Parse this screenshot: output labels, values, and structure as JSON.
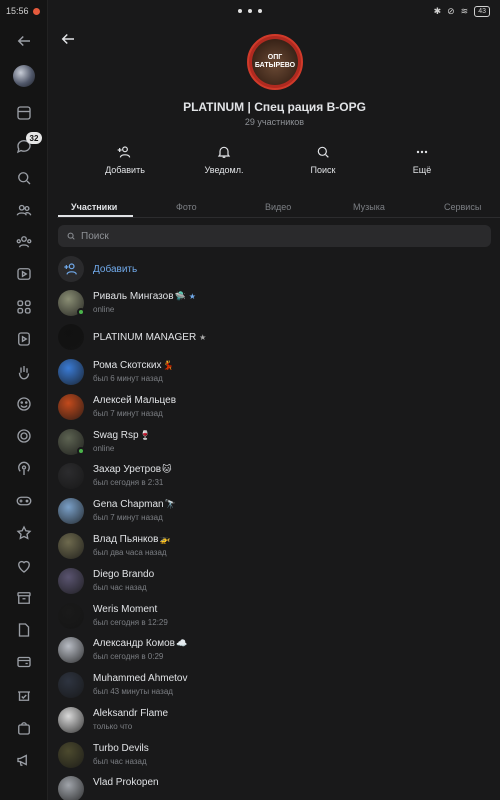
{
  "status_bar": {
    "time": "15:56",
    "battery": "43"
  },
  "sidebar": {
    "unread_badge": "32",
    "icons": [
      "back-arrow-icon",
      "avatar",
      "window-icon",
      "chat-icon",
      "search-icon",
      "friends-icon",
      "groups-icon",
      "clips-icon",
      "apps-icon",
      "video-icon",
      "hand-icon",
      "smile-icon",
      "target-icon",
      "podcast-icon",
      "gamepad-icon",
      "star-icon",
      "heart-icon",
      "archive-icon",
      "document-icon",
      "wallet-icon",
      "market-icon",
      "bag-icon",
      "megaphone-icon"
    ]
  },
  "group": {
    "avatar_text": "ОПГ БАТЫРЕВО",
    "title": "PLATINUM | Спец рация B-OPG",
    "subtitle": "29 участников"
  },
  "actions": [
    {
      "label": "Добавить",
      "icon": "add-user-icon"
    },
    {
      "label": "Уведомл.",
      "icon": "bell-icon"
    },
    {
      "label": "Поиск",
      "icon": "search-icon"
    },
    {
      "label": "Ещё",
      "icon": "more-dots-icon"
    }
  ],
  "tabs": [
    "Участники",
    "Фото",
    "Видео",
    "Музыка",
    "Сервисы"
  ],
  "search": {
    "placeholder": "Поиск"
  },
  "add_member": {
    "label": "Добавить"
  },
  "members": [
    {
      "name": "Риваль Мингазов",
      "emoji": "🛸",
      "verified": "★",
      "status": "online",
      "online": true,
      "avatar_color": "#8a8e74"
    },
    {
      "name": "PLATINUM MANAGER",
      "emoji": "",
      "star": "★",
      "status": "",
      "online": false,
      "avatar_color": "#111111"
    },
    {
      "name": "Рома Скотских",
      "emoji": "💃",
      "status": "был 6 минут назад",
      "online": false,
      "avatar_color": "#3a7bd5"
    },
    {
      "name": "Алексей Мальцев",
      "emoji": "",
      "status": "был 7 минут назад",
      "online": false,
      "avatar_color": "#c24a1c"
    },
    {
      "name": "Swag Rsp",
      "emoji": "🍷",
      "status": "online",
      "online": true,
      "avatar_color": "#5d6352"
    },
    {
      "name": "Захар Уретров",
      "emoji": "🐱",
      "status": "был сегодня в 2:31",
      "online": false,
      "avatar_color": "#2c2c2e"
    },
    {
      "name": "Gena Chapman",
      "emoji": "🔭",
      "status": "был 7 минут назад",
      "online": false,
      "avatar_color": "#7aa0c8"
    },
    {
      "name": "Влад Пьянков",
      "emoji": "🚁",
      "status": "был два часа назад",
      "online": false,
      "avatar_color": "#6e6a4e"
    },
    {
      "name": "Diego Brando",
      "emoji": "",
      "status": "был час назад",
      "online": false,
      "avatar_color": "#5a5470"
    },
    {
      "name": "Weris Moment",
      "emoji": "",
      "status": "был сегодня в 12:29",
      "online": false,
      "avatar_color": "#1a1a1a"
    },
    {
      "name": "Александр Комов",
      "emoji": "☁️",
      "status": "был сегодня в 0:29",
      "online": false,
      "avatar_color": "#b8bcc4"
    },
    {
      "name": "Muhammed Ahmetov",
      "emoji": "",
      "status": "был 43 минуты назад",
      "online": false,
      "avatar_color": "#2e3440"
    },
    {
      "name": "Aleksandr Flame",
      "emoji": "",
      "status": "только что",
      "online": false,
      "avatar_color": "#d9d9d9"
    },
    {
      "name": "Turbo Devils",
      "emoji": "",
      "status": "был час назад",
      "online": false,
      "avatar_color": "#4c4a2e"
    },
    {
      "name": "Vlad Prokopen",
      "emoji": "",
      "status": "",
      "online": false,
      "avatar_color": "#a0a4aa"
    }
  ]
}
